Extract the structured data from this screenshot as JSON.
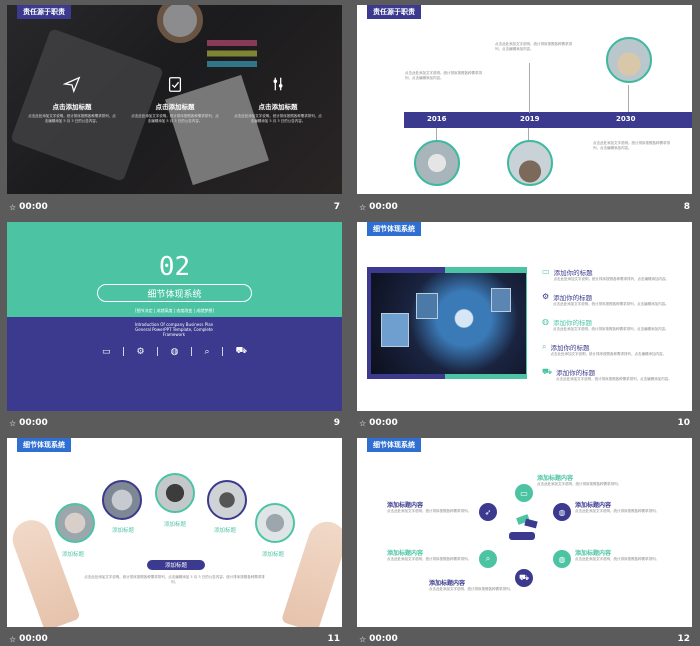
{
  "slides": [
    {
      "number": "7",
      "time": "00:00",
      "tag": "责任源于职责",
      "items": [
        {
          "title": "点击添加标题",
          "text": "点击此处添加文字说明。统计排序按照各种需求排列，点击编辑添加 5 月 3 日的公告内容。"
        },
        {
          "title": "点击添加标题",
          "text": "点击此处添加文字说明。统计排序按照各种需求排列，点击编辑添加 5 月 3 日的公告内容。"
        },
        {
          "title": "点击添加标题",
          "text": "点击此处添加文字说明。统计排序按照各种需求排列，点击编辑添加 5 月 3 日的公告内容。"
        }
      ]
    },
    {
      "number": "8",
      "time": "00:00",
      "tag": "责任源于职责",
      "years": [
        "2016",
        "2019",
        "2030"
      ],
      "notes": [
        "点击此处添加文字说明。统计排序按照各种需求排列，点击编辑添加内容。",
        "点击此处添加文字说明。统计排序按照各种需求排列，点击编辑添加内容。",
        "点击此处添加文字说明。统计排序按照各种需求排列，点击编辑添加内容。"
      ]
    },
    {
      "number": "9",
      "time": "00:00",
      "big_number": "02",
      "title": "细节体现系统",
      "subtitle": "[细节决定 | 成就高度 | 态度改变 | 成就梦想]",
      "english": "Introduction Of company Business Plan General PowerPPT Template, Complete Framework"
    },
    {
      "number": "10",
      "time": "00:00",
      "tag": "细节体现系统",
      "items": [
        {
          "title": "添加你的标题",
          "text": "点击此处添加文字说明，统计排序按照各种需求排列，点击编辑添加内容。"
        },
        {
          "title": "添加你的标题",
          "text": "点击此处添加文字说明，统计排序按照各种需求排列，点击编辑添加内容。"
        },
        {
          "title": "添加你的标题",
          "text": "点击此处添加文字说明，统计排序按照各种需求排列，点击编辑添加内容。"
        },
        {
          "title": "添加你的标题",
          "text": "点击此处添加文字说明，统计排序按照各种需求排列，点击编辑添加内容。"
        },
        {
          "title": "添加你的标题",
          "text": "点击此处添加文字说明，统计排序按照各种需求排列，点击编辑添加内容。"
        }
      ]
    },
    {
      "number": "11",
      "time": "00:00",
      "tag": "细节体现系统",
      "labels": [
        "添加标题",
        "添加标题",
        "添加标题",
        "添加标题",
        "添加标题"
      ],
      "center_label": "添加标题",
      "center_text": "点击此处添加文字说明。统计排序按照各种需求排列，点击编辑添加 5 月 3 日的公告内容。统计排序按照各种需求排列。"
    },
    {
      "number": "12",
      "time": "00:00",
      "tag": "细节体现系统",
      "left_items": [
        {
          "title": "添加标题内容",
          "text": "点击此处添加文字说明，统计排序按照各种需求排列。"
        },
        {
          "title": "添加标题内容",
          "text": "点击此处添加文字说明，统计排序按照各种需求排列。"
        },
        {
          "title": "添加标题内容",
          "text": "点击此处添加文字说明，统计排序按照各种需求排列。"
        }
      ],
      "right_items": [
        {
          "title": "添加标题内容",
          "text": "点击此处添加文字说明，统计排序按照各种需求排列。"
        },
        {
          "title": "添加标题内容",
          "text": "点击此处添加文字说明，统计排序按照各种需求排列。"
        },
        {
          "title": "添加标题内容",
          "text": "点击此处添加文字说明，统计排序按照各种需求排列。"
        }
      ]
    }
  ],
  "colors": {
    "navy": "#3b3a8e",
    "teal": "#4cc4a4",
    "blue_tag": "#2f6fd1"
  }
}
